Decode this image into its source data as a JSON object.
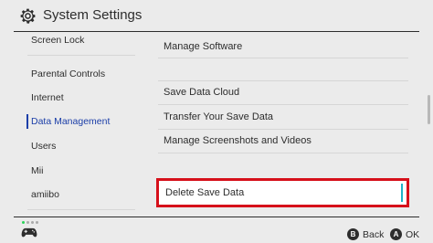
{
  "header": {
    "title": "System Settings",
    "icon": "gear-icon"
  },
  "sidebar": {
    "items": [
      {
        "label": "Screen Lock"
      },
      {
        "label": "Parental Controls"
      },
      {
        "label": "Internet"
      },
      {
        "label": "Data Management",
        "active": true
      },
      {
        "label": "Users"
      },
      {
        "label": "Mii"
      },
      {
        "label": "amiibo"
      }
    ]
  },
  "main": {
    "items": [
      {
        "label": "Manage Software"
      },
      {
        "label": "Save Data Cloud"
      },
      {
        "label": "Transfer Your Save Data"
      },
      {
        "label": "Manage Screenshots and Videos"
      }
    ],
    "selected": {
      "label": "Delete Save Data"
    }
  },
  "footer": {
    "back": {
      "glyph": "B",
      "label": "Back"
    },
    "ok": {
      "glyph": "A",
      "label": "OK"
    }
  },
  "colors": {
    "accent": "#1b3ea8",
    "selection_border": "#d6101a",
    "cursor": "#1fb2c8"
  }
}
